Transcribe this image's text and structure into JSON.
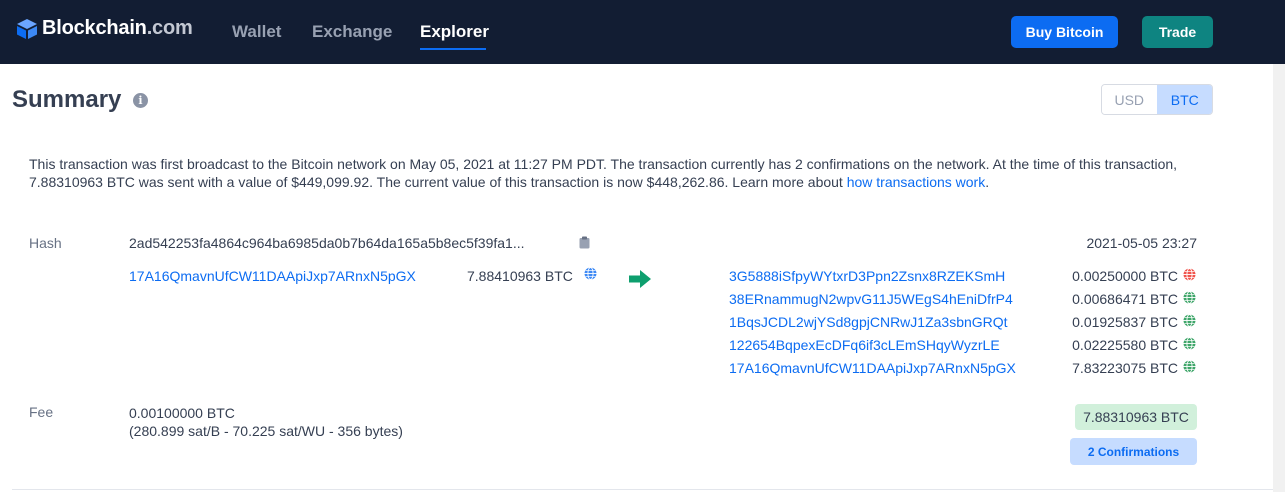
{
  "header": {
    "brand_main": "Blockchain",
    "brand_suffix": ".com",
    "nav": [
      {
        "label": "Wallet"
      },
      {
        "label": "Exchange"
      },
      {
        "label": "Explorer"
      }
    ],
    "buy_label": "Buy Bitcoin",
    "trade_label": "Trade",
    "colors": {
      "navbar": "#121d33",
      "buy": "#0c6cf2",
      "trade": "#0e8481"
    }
  },
  "summary": {
    "title": "Summary",
    "info_icon": "info-icon",
    "currency_toggle": {
      "usd": "USD",
      "btc": "BTC",
      "selected": "BTC"
    },
    "description": "This transaction was first broadcast to the Bitcoin network on May 05, 2021 at 11:27 PM PDT.  The transaction currently has 2 confirmations on the network.  At the time of this transaction, 7.88310963 BTC was sent with a value of $449,099.92. The current value of this transaction is now $448,262.86.  Learn more about ",
    "learn_link": "how transactions work",
    "description_end": "."
  },
  "tx": {
    "hash_label": "Hash",
    "hash": "2ad542253fa4864c964ba6985da0b7b64da165a5b8ec5f39fa1...",
    "timestamp": "2021-05-05 23:27",
    "input": {
      "address": "17A16QmavnUfCW11DAApiJxp7ARnxN5pGX",
      "amount": "7.88410963 BTC",
      "status": "spent-blue"
    },
    "outputs": [
      {
        "address": "3G5888iSfpyWYtxrD3Ppn2Zsnx8RZEKSmH",
        "amount": "0.00250000 BTC",
        "status": "spent-red"
      },
      {
        "address": "38ERnammugN2wpvG11J5WEgS4hEniDfrP4",
        "amount": "0.00686471 BTC",
        "status": "unspent-green"
      },
      {
        "address": "1BqsJCDL2wjYSd8gpjCNRwJ1Za3sbnGRQt",
        "amount": "0.01925837 BTC",
        "status": "unspent-green"
      },
      {
        "address": "122654BqpexEcDFq6if3cLEmSHqyWyzrLE",
        "amount": "0.02225580 BTC",
        "status": "unspent-green"
      },
      {
        "address": "17A16QmavnUfCW11DAApiJxp7ARnxN5pGX",
        "amount": "7.83223075 BTC",
        "status": "unspent-green"
      }
    ],
    "fee_label": "Fee",
    "fee_btc": "0.00100000 BTC",
    "fee_detail": "(280.899 sat/B - 70.225 sat/WU - 356 bytes)",
    "total": "7.88310963 BTC",
    "confirmations": "2 Confirmations"
  }
}
